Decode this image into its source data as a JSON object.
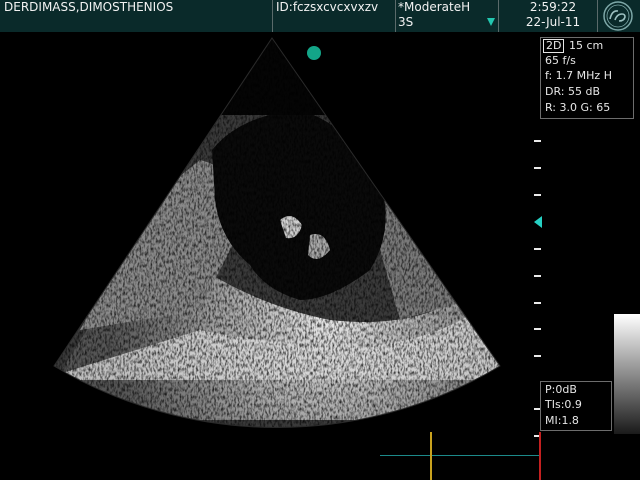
{
  "header": {
    "patient_name": "DERDIMASS,DIMOSTHENIOS",
    "patient_id": "ID:fczsxcvcxvxzv",
    "preset": "*ModerateH",
    "probe": "3S",
    "time": "2:59:22",
    "date": "22-Jul-11",
    "logo_icon": "ge-logo"
  },
  "parameters": {
    "mode": "2D",
    "depth": "15 cm",
    "frame_rate": "65 f/s",
    "frequency": "f: 1.7 MHz H",
    "dynamic_range": "DR: 55 dB",
    "reject_gain": "R: 3.0   G: 65"
  },
  "acoustic": {
    "power": "P:0dB",
    "tis": "TIs:0.9",
    "mi": "MI:1.8"
  },
  "colors": {
    "header_bg": "#0a2a2a",
    "accent_teal": "#22c7b0",
    "marker_green": "#13a588",
    "cursor_red": "#c42020",
    "cursor_yellow": "#c9a21e"
  }
}
